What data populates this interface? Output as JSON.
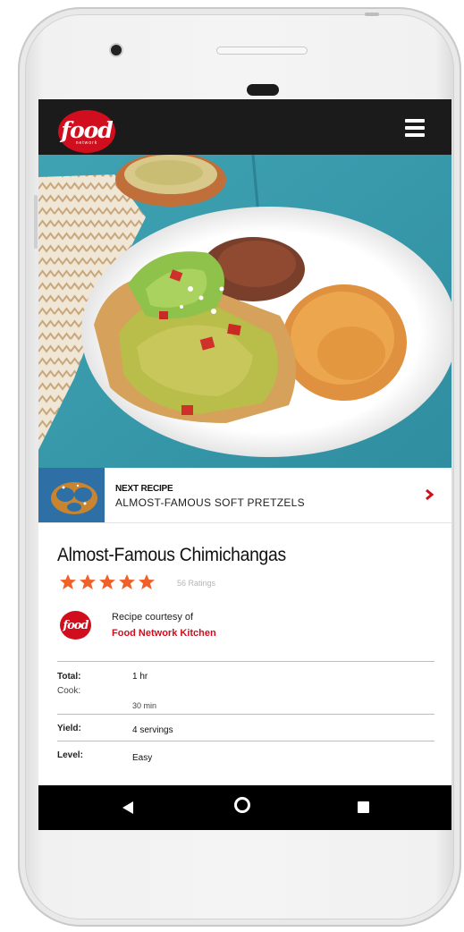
{
  "app": {
    "logo_text": "food",
    "logo_subtext": "network"
  },
  "next_recipe": {
    "kicker": "NEXT RECIPE",
    "title": "ALMOST-FAMOUS SOFT PRETZELS"
  },
  "recipe": {
    "title": "Almost-Famous Chimichangas",
    "rating_stars": 5,
    "ratings_text": "56 Ratings",
    "courtesy_label": "Recipe courtesy of",
    "author": "Food Network Kitchen",
    "source_logo_text": "food"
  },
  "details": [
    {
      "label": "Total:",
      "value": "1 hr"
    },
    {
      "label": "Cook:",
      "value": "30 min"
    },
    {
      "label": "Yield:",
      "value": "4 servings"
    },
    {
      "label": "Level:",
      "value": "Easy"
    }
  ],
  "colors": {
    "brand_red": "#d10e1d",
    "star_orange": "#f0612a",
    "appbar": "#1b1b1b"
  },
  "icons": [
    "menu-icon",
    "chevron-right-icon",
    "star-icon",
    "back-icon",
    "home-icon",
    "recents-icon"
  ]
}
